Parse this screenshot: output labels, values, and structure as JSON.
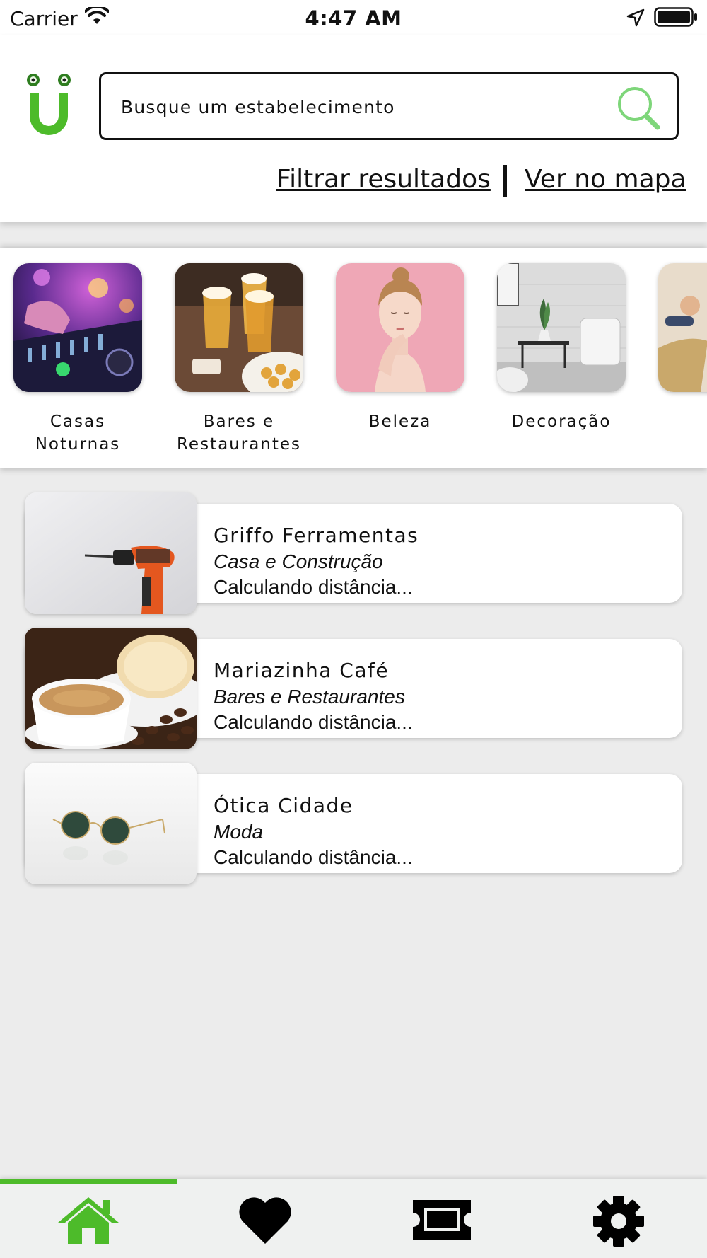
{
  "status_bar": {
    "carrier": "Carrier",
    "time": "4:47 AM"
  },
  "header": {
    "logo_icon": "app-logo-u-with-eyes",
    "search": {
      "placeholder": "Busque um estabelecimento",
      "value": ""
    },
    "links": {
      "filter": "Filtrar resultados",
      "map": "Ver no mapa"
    }
  },
  "categories": [
    {
      "label": "Casas Noturnas",
      "image": "dj-mixer-photo"
    },
    {
      "label": "Bares e Restaurantes",
      "image": "beer-toast-photo"
    },
    {
      "label": "Beleza",
      "image": "woman-portrait-photo"
    },
    {
      "label": "Decoração",
      "image": "living-room-photo"
    },
    {
      "label": "",
      "image": "person-photo"
    }
  ],
  "listings": [
    {
      "name": "Griffo Ferramentas",
      "category": "Casa e Construção",
      "distance": "Calculando distância..."
    },
    {
      "name": "Mariazinha Café",
      "category": "Bares e Restaurantes",
      "distance": "Calculando distância..."
    },
    {
      "name": "Ótica Cidade",
      "category": "Moda",
      "distance": "Calculando distância..."
    }
  ],
  "tab_bar": {
    "tabs": [
      {
        "icon": "home-icon",
        "active": true
      },
      {
        "icon": "heart-icon",
        "active": false
      },
      {
        "icon": "ticket-icon",
        "active": false
      },
      {
        "icon": "gear-icon",
        "active": false
      }
    ],
    "active_color": "#4dbb2a",
    "inactive_color": "#000000"
  },
  "colors": {
    "brand_green": "#4dbb2a",
    "search_icon_green": "#7ed67a",
    "background": "#ececec"
  }
}
